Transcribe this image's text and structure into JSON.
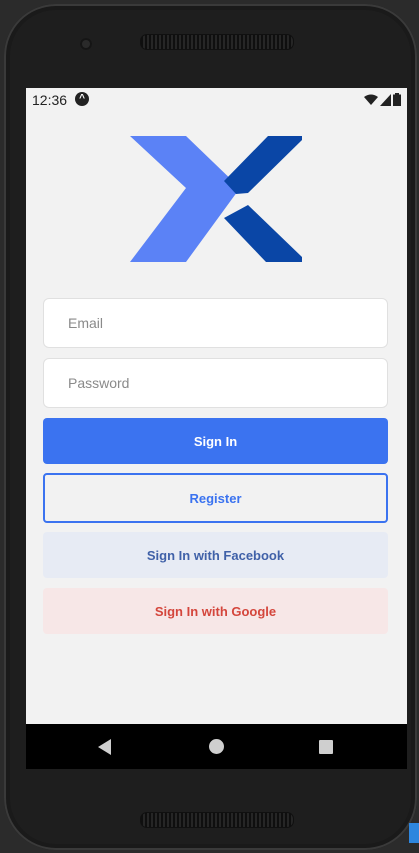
{
  "status_bar": {
    "time": "12:36",
    "icons": [
      "app-notification-icon",
      "wifi-icon",
      "signal-icon",
      "battery-icon"
    ]
  },
  "logo": {
    "name": "x-logo",
    "colors": {
      "light": "#5b82f6",
      "dark": "#0a46a6"
    }
  },
  "form": {
    "email_placeholder": "Email",
    "password_placeholder": "Password"
  },
  "buttons": {
    "sign_in": "Sign In",
    "register": "Register",
    "facebook": "Sign In with Facebook",
    "google": "Sign In with Google"
  },
  "colors": {
    "primary": "#3b73f0",
    "facebook_text": "#4061a8",
    "facebook_bg": "#e7ebf4",
    "google_text": "#d4463c",
    "google_bg": "#f7e7e7",
    "screen_bg": "#f2f2f2"
  },
  "nav_bar": {
    "icons": [
      "back-icon",
      "home-icon",
      "recents-icon"
    ]
  }
}
